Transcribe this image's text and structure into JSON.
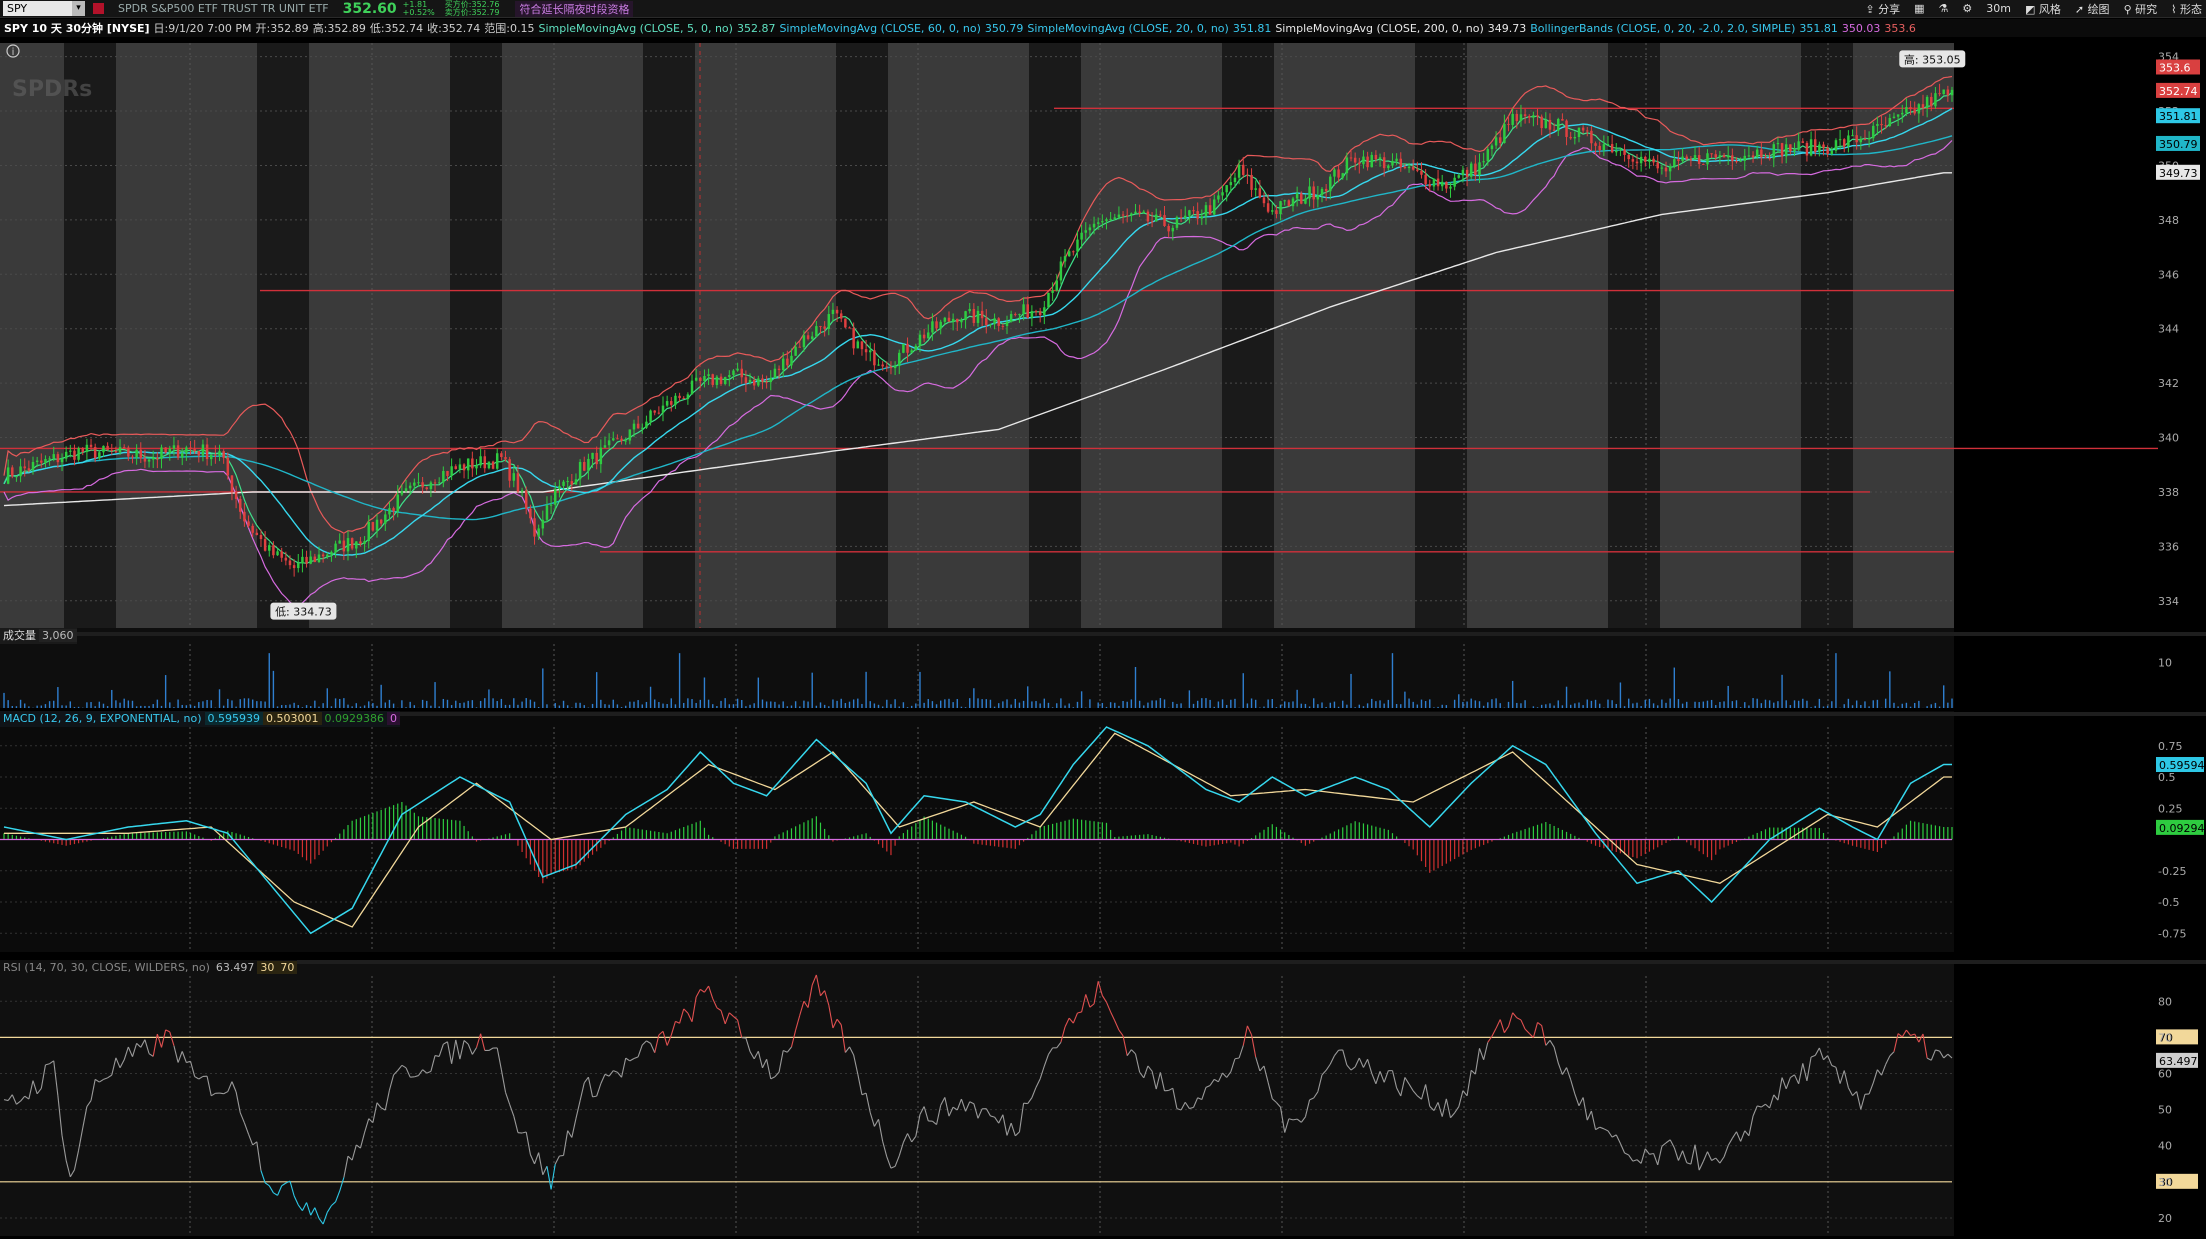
{
  "header": {
    "symbol": "SPY",
    "name": "SPDR S&P500 ETF TRUST TR UNIT ETF",
    "last": "352.60",
    "change_abs": "+1.81",
    "change_pct": "+0.52%",
    "bid": "买方价:352.76",
    "ask": "卖方价:352.79",
    "extended": "符合延长隔夜时段资格",
    "tools": [
      "分享",
      "30m",
      "风格",
      "绘图",
      "研究",
      "形态"
    ]
  },
  "info": {
    "title": "SPY 10 天 30分钟 [NYSE]",
    "date": "日:9/1/20 7:00 PM",
    "open": "开:352.89",
    "high": "高:352.89",
    "low": "低:352.74",
    "close": "收:352.74",
    "range": "范围:0.15",
    "sma5_label": "SimpleMovingAvg (CLOSE, 5, 0, no)",
    "sma5_val": "352.87",
    "sma60_label": "SimpleMovingAvg (CLOSE, 60, 0, no)",
    "sma60_val": "350.79",
    "sma20_label": "SimpleMovingAvg (CLOSE, 20, 0, no)",
    "sma20_val": "351.81",
    "sma200_label": "SimpleMovingAvg (CLOSE, 200, 0, no)",
    "sma200_val": "349.73",
    "bb_label": "BollingerBands (CLOSE, 0, 20, -2.0, 2.0, SIMPLE)",
    "bb_mid": "351.81",
    "bb_low": "350.03",
    "bb_up": "353.6"
  },
  "volume_pane": {
    "label": "成交量",
    "value": "3,060"
  },
  "macd_pane": {
    "label": "MACD (12, 26, 9, EXPONENTIAL, no)",
    "value": "0.595939",
    "avg": "0.503001",
    "diff": "0.0929386",
    "zero": "0"
  },
  "rsi_pane": {
    "label": "RSI (14, 70, 30, CLOSE, WILDERS, no)",
    "value": "63.497",
    "os": "30",
    "ob": "70"
  },
  "chart_data": [
    {
      "type": "candlestick",
      "title": "SPY 10 天 30分钟 [NYSE]",
      "ylim": [
        333,
        354.5
      ],
      "yticks": [
        334,
        336,
        338,
        340,
        342,
        344,
        346,
        348,
        350,
        352,
        354
      ],
      "high_label": "高: 353.05",
      "low_label": "低: 334.73",
      "close_path": [
        [
          0,
          338.6
        ],
        [
          8,
          339.0
        ],
        [
          18,
          339.5
        ],
        [
          28,
          339.4
        ],
        [
          36,
          339.3
        ],
        [
          44,
          339.6
        ],
        [
          52,
          339.4
        ],
        [
          58,
          337.0
        ],
        [
          64,
          335.8
        ],
        [
          70,
          335.2
        ],
        [
          78,
          335.8
        ],
        [
          86,
          336.3
        ],
        [
          96,
          337.8
        ],
        [
          104,
          338.6
        ],
        [
          112,
          339.0
        ],
        [
          120,
          339.2
        ],
        [
          124,
          338.2
        ],
        [
          128,
          336.5
        ],
        [
          132,
          337.8
        ],
        [
          140,
          339.0
        ],
        [
          148,
          339.8
        ],
        [
          158,
          341.0
        ],
        [
          168,
          342.0
        ],
        [
          176,
          342.3
        ],
        [
          184,
          342.0
        ],
        [
          192,
          343.5
        ],
        [
          200,
          344.5
        ],
        [
          208,
          343.0
        ],
        [
          214,
          342.8
        ],
        [
          222,
          343.8
        ],
        [
          230,
          344.5
        ],
        [
          240,
          344.3
        ],
        [
          250,
          344.8
        ],
        [
          256,
          346.5
        ],
        [
          264,
          348.0
        ],
        [
          272,
          348.1
        ],
        [
          282,
          347.8
        ],
        [
          292,
          348.5
        ],
        [
          298,
          349.8
        ],
        [
          306,
          348.3
        ],
        [
          318,
          349.2
        ],
        [
          326,
          350.3
        ],
        [
          334,
          350.1
        ],
        [
          342,
          349.6
        ],
        [
          348,
          349.3
        ],
        [
          356,
          350.0
        ],
        [
          364,
          351.7
        ],
        [
          374,
          351.5
        ],
        [
          382,
          351.0
        ],
        [
          392,
          350.5
        ],
        [
          400,
          349.8
        ],
        [
          410,
          350.3
        ],
        [
          418,
          350.4
        ],
        [
          428,
          350.6
        ],
        [
          440,
          350.7
        ],
        [
          448,
          351.0
        ],
        [
          456,
          351.6
        ],
        [
          464,
          352.3
        ],
        [
          468,
          352.6
        ]
      ],
      "sma200_path": [
        [
          0,
          337.5
        ],
        [
          60,
          338.0
        ],
        [
          130,
          338.0
        ],
        [
          200,
          339.5
        ],
        [
          240,
          340.3
        ],
        [
          280,
          342.5
        ],
        [
          320,
          344.8
        ],
        [
          360,
          346.8
        ],
        [
          400,
          348.2
        ],
        [
          440,
          349.0
        ],
        [
          468,
          349.73
        ]
      ],
      "horizontal_lines": [
        352.1,
        345.4,
        339.6,
        338.0,
        335.8
      ],
      "n_bars": 470
    },
    {
      "type": "bar",
      "title": "成交量",
      "ylim": [
        0,
        14
      ],
      "yticks": [
        10
      ],
      "values_note": "low volume bars with spikes"
    },
    {
      "type": "line",
      "title": "MACD (12, 26, 9, EXPONENTIAL, no)",
      "ylim": [
        -0.9,
        0.9
      ],
      "yticks": [
        0.75,
        0.5,
        0.25,
        -0.25,
        -0.5,
        -0.75
      ],
      "series": [
        {
          "name": "Value",
          "points": [
            [
              0,
              0.1
            ],
            [
              15,
              0.0
            ],
            [
              30,
              0.1
            ],
            [
              44,
              0.15
            ],
            [
              54,
              0.05
            ],
            [
              64,
              -0.35
            ],
            [
              74,
              -0.75
            ],
            [
              84,
              -0.55
            ],
            [
              96,
              0.2
            ],
            [
              110,
              0.5
            ],
            [
              122,
              0.3
            ],
            [
              130,
              -0.3
            ],
            [
              138,
              -0.2
            ],
            [
              150,
              0.2
            ],
            [
              160,
              0.4
            ],
            [
              168,
              0.7
            ],
            [
              176,
              0.45
            ],
            [
              184,
              0.35
            ],
            [
              196,
              0.8
            ],
            [
              208,
              0.45
            ],
            [
              214,
              0.05
            ],
            [
              222,
              0.35
            ],
            [
              232,
              0.3
            ],
            [
              244,
              0.1
            ],
            [
              250,
              0.2
            ],
            [
              258,
              0.6
            ],
            [
              266,
              0.9
            ],
            [
              276,
              0.75
            ],
            [
              290,
              0.4
            ],
            [
              298,
              0.3
            ],
            [
              306,
              0.5
            ],
            [
              314,
              0.35
            ],
            [
              326,
              0.5
            ],
            [
              334,
              0.4
            ],
            [
              344,
              0.1
            ],
            [
              354,
              0.45
            ],
            [
              364,
              0.75
            ],
            [
              372,
              0.6
            ],
            [
              384,
              0.05
            ],
            [
              394,
              -0.35
            ],
            [
              404,
              -0.25
            ],
            [
              412,
              -0.5
            ],
            [
              426,
              0.0
            ],
            [
              438,
              0.25
            ],
            [
              446,
              0.1
            ],
            [
              452,
              0.0
            ],
            [
              460,
              0.45
            ],
            [
              468,
              0.6
            ]
          ]
        },
        {
          "name": "Avg",
          "points": [
            [
              0,
              0.05
            ],
            [
              30,
              0.05
            ],
            [
              50,
              0.1
            ],
            [
              70,
              -0.5
            ],
            [
              84,
              -0.7
            ],
            [
              100,
              0.1
            ],
            [
              114,
              0.45
            ],
            [
              132,
              0.0
            ],
            [
              150,
              0.1
            ],
            [
              170,
              0.6
            ],
            [
              186,
              0.4
            ],
            [
              200,
              0.7
            ],
            [
              216,
              0.1
            ],
            [
              234,
              0.3
            ],
            [
              250,
              0.1
            ],
            [
              268,
              0.85
            ],
            [
              296,
              0.35
            ],
            [
              314,
              0.4
            ],
            [
              340,
              0.3
            ],
            [
              364,
              0.7
            ],
            [
              394,
              -0.2
            ],
            [
              414,
              -0.35
            ],
            [
              440,
              0.2
            ],
            [
              452,
              0.1
            ],
            [
              468,
              0.5
            ]
          ]
        }
      ]
    },
    {
      "type": "line",
      "title": "RSI (14, 70, 30, CLOSE, WILDERS, no)",
      "ylim": [
        15,
        87
      ],
      "yticks": [
        80,
        70,
        60,
        50,
        40,
        30,
        20
      ],
      "overbought": 70,
      "oversold": 30,
      "points": [
        [
          0,
          50
        ],
        [
          6,
          55
        ],
        [
          12,
          62
        ],
        [
          16,
          30
        ],
        [
          22,
          58
        ],
        [
          30,
          64
        ],
        [
          40,
          70
        ],
        [
          46,
          58
        ],
        [
          56,
          55
        ],
        [
          64,
          30
        ],
        [
          72,
          25
        ],
        [
          78,
          21
        ],
        [
          86,
          42
        ],
        [
          96,
          60
        ],
        [
          108,
          66
        ],
        [
          118,
          70
        ],
        [
          124,
          45
        ],
        [
          132,
          30
        ],
        [
          140,
          55
        ],
        [
          150,
          62
        ],
        [
          162,
          72
        ],
        [
          170,
          83
        ],
        [
          176,
          73
        ],
        [
          186,
          60
        ],
        [
          196,
          84
        ],
        [
          204,
          66
        ],
        [
          214,
          36
        ],
        [
          222,
          48
        ],
        [
          232,
          52
        ],
        [
          244,
          44
        ],
        [
          250,
          62
        ],
        [
          258,
          75
        ],
        [
          264,
          83
        ],
        [
          274,
          62
        ],
        [
          284,
          52
        ],
        [
          294,
          58
        ],
        [
          300,
          70
        ],
        [
          310,
          44
        ],
        [
          322,
          66
        ],
        [
          330,
          61
        ],
        [
          342,
          54
        ],
        [
          350,
          50
        ],
        [
          358,
          68
        ],
        [
          364,
          76
        ],
        [
          372,
          70
        ],
        [
          384,
          45
        ],
        [
          394,
          35
        ],
        [
          404,
          39
        ],
        [
          414,
          34
        ],
        [
          424,
          51
        ],
        [
          438,
          64
        ],
        [
          448,
          53
        ],
        [
          458,
          70
        ],
        [
          464,
          67
        ],
        [
          468,
          63.5
        ]
      ]
    }
  ]
}
